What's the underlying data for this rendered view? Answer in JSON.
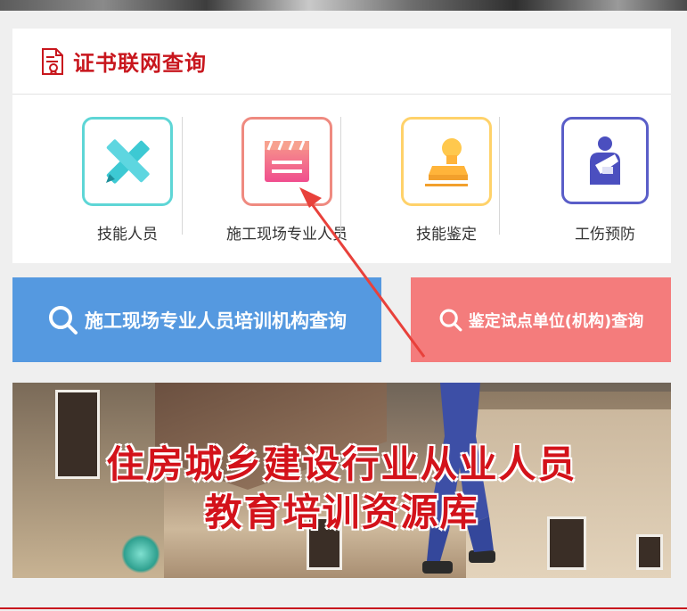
{
  "certificate": {
    "title": "证书联网查询",
    "categories": [
      {
        "label": "技能人员",
        "icon": "tools-icon",
        "border": "#5ed6d6"
      },
      {
        "label": "施工现场专业人员",
        "icon": "clapperboard-icon",
        "border": "#ef8a80"
      },
      {
        "label": "技能鉴定",
        "icon": "stamp-icon",
        "border": "#ffd26a"
      },
      {
        "label": "工伤预防",
        "icon": "injured-person-icon",
        "border": "#5a5ec8"
      }
    ]
  },
  "search": {
    "training_query_label": "施工现场专业人员培训机构查询",
    "appraisal_query_label": "鉴定试点单位(机构)查询"
  },
  "banner": {
    "line1": "住房城乡建设行业从业人员",
    "line2": "教育培训资源库"
  },
  "colors": {
    "brand_red": "#c8161d",
    "blue_button": "#5599e0",
    "red_button": "#f47c7c",
    "annotation_arrow": "#e8413b"
  }
}
